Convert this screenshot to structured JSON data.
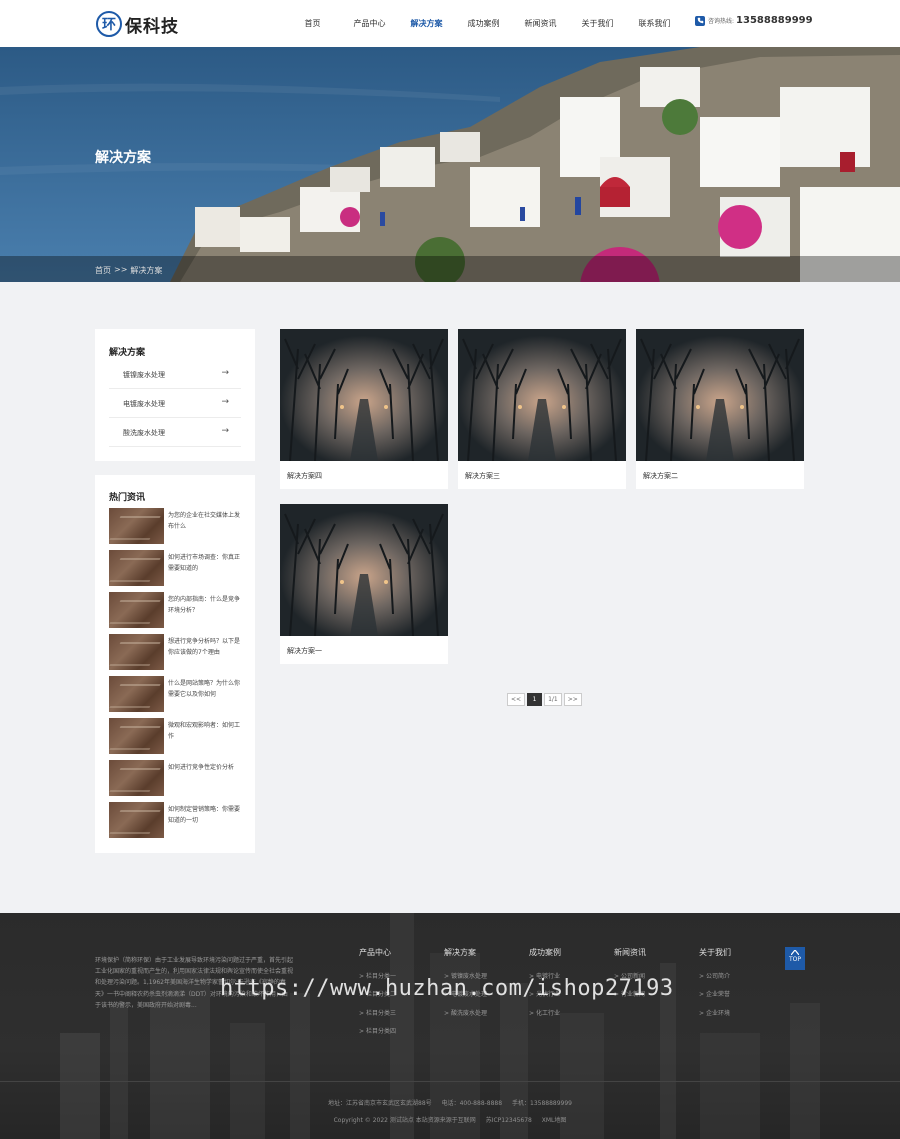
{
  "header": {
    "logo_mark": "环",
    "logo_text": "保科技",
    "nav": [
      "首页",
      "产品中心",
      "解决方案",
      "成功案例",
      "新闻资讯",
      "关于我们",
      "联系我们"
    ],
    "active_index": 2,
    "hotline_label": "咨询热线:",
    "hotline_number": "13588889999"
  },
  "banner": {
    "title": "解决方案",
    "breadcrumb": [
      "首页",
      ">>",
      "解决方案"
    ]
  },
  "sidebar": {
    "categories_title": "解决方案",
    "categories": [
      "镀镍废水处理",
      "电镀废水处理",
      "酸洗废水处理"
    ],
    "arrow": "→",
    "news_title": "热门资讯",
    "news": [
      "为您的企业在社交媒体上发布什么",
      "如何进行市场调查：你真正需要知道的",
      "您的内部指南：什么是竞争环境分析？",
      "想进行竞争分析吗？以下是你应该做的7个理由",
      "什么是网站策略？为什么你需要它以及你如何",
      "微观和宏观影响者：如何工作",
      "如何进行竞争性定价分析",
      "如何制定营销策略：你需要知道的一切"
    ]
  },
  "cards": [
    "解决方案四",
    "解决方案三",
    "解决方案二",
    "解决方案一"
  ],
  "pagination": {
    "prev": "<<",
    "current": "1",
    "total": "1/1",
    "next": ">>"
  },
  "footer": {
    "about": "环境保护（简称环保）由于工业发展导致环境污染问题过于严重，首先引起工业化国家的重视而产生的，利用国家法律法规和舆论宣传而使全社会重视和处理污染问题。1,1962年美国海洋生物学家蕾切尔·卡逊在《寂静的春天》一书中阐释农药杀虫剂滴滴涕（DDT）对环境的污染和破坏作用，由于该书的警示，美国政府开始对剧毒...",
    "columns": [
      {
        "title": "产品中心",
        "links": [
          "栏目分类一",
          "栏目分类二",
          "栏目分类三",
          "栏目分类四"
        ]
      },
      {
        "title": "解决方案",
        "links": [
          "镀镍废水处理",
          "电镀废水处理",
          "酸洗废水处理"
        ]
      },
      {
        "title": "成功案例",
        "links": [
          "电镀行业",
          "光伏行业",
          "化工行业"
        ]
      },
      {
        "title": "新闻资讯",
        "links": [
          "公司新闻",
          "行业新闻"
        ]
      },
      {
        "title": "关于我们",
        "links": [
          "公司简介",
          "企业荣誉",
          "企业环境"
        ]
      }
    ],
    "link_prefix": ">",
    "top_label": "TOP",
    "address": "地址：江苏省南京市玄武区玄武湖88号",
    "tel": "电话：400-888-8888",
    "mobile": "手机：13588889999",
    "copyright": "Copyright © 2022 测试站点 本站资源来源于互联网",
    "icp": "苏ICP12345678",
    "sitemap": "XML地图"
  },
  "watermark": "https://www.huzhan.com/ishop27193"
}
